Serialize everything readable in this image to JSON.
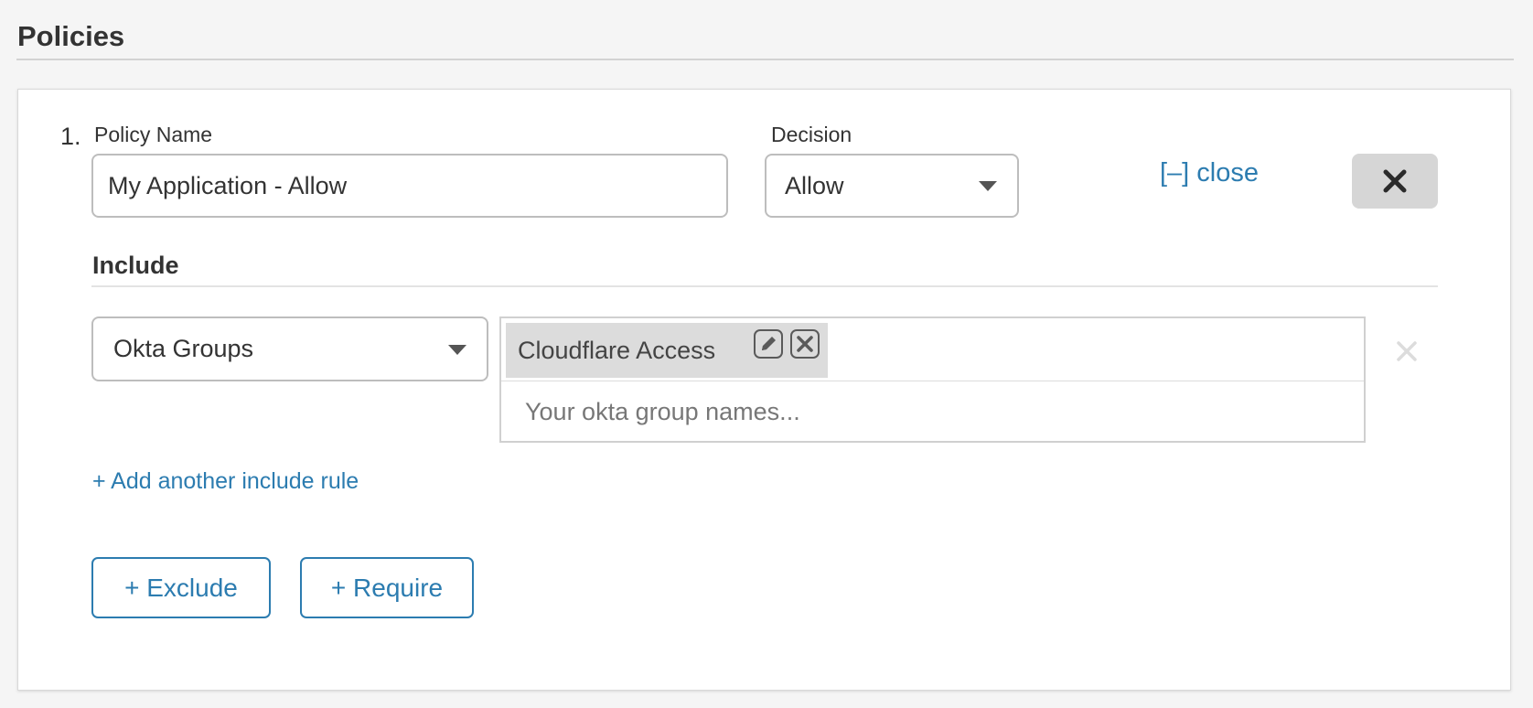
{
  "section": {
    "title": "Policies"
  },
  "policy": {
    "number": "1.",
    "name_label": "Policy Name",
    "name_value": "My Application - Allow",
    "decision_label": "Decision",
    "decision_value": "Allow",
    "collapse_link": "[–] close",
    "remove_icon": "close-icon"
  },
  "include": {
    "heading": "Include",
    "rule": {
      "type": "Okta Groups",
      "tags": [
        {
          "label": "Cloudflare Access"
        }
      ],
      "input_placeholder": "Your okta group names..."
    },
    "add_rule_link": "+ Add another include rule"
  },
  "actions": {
    "exclude_label": "+ Exclude",
    "require_label": "+ Require"
  },
  "colors": {
    "link": "#2c7cb0",
    "background": "#f5f5f5",
    "card": "#ffffff",
    "close_button_bg": "#d6d6d6",
    "tag_bg": "#dcdcdc"
  }
}
